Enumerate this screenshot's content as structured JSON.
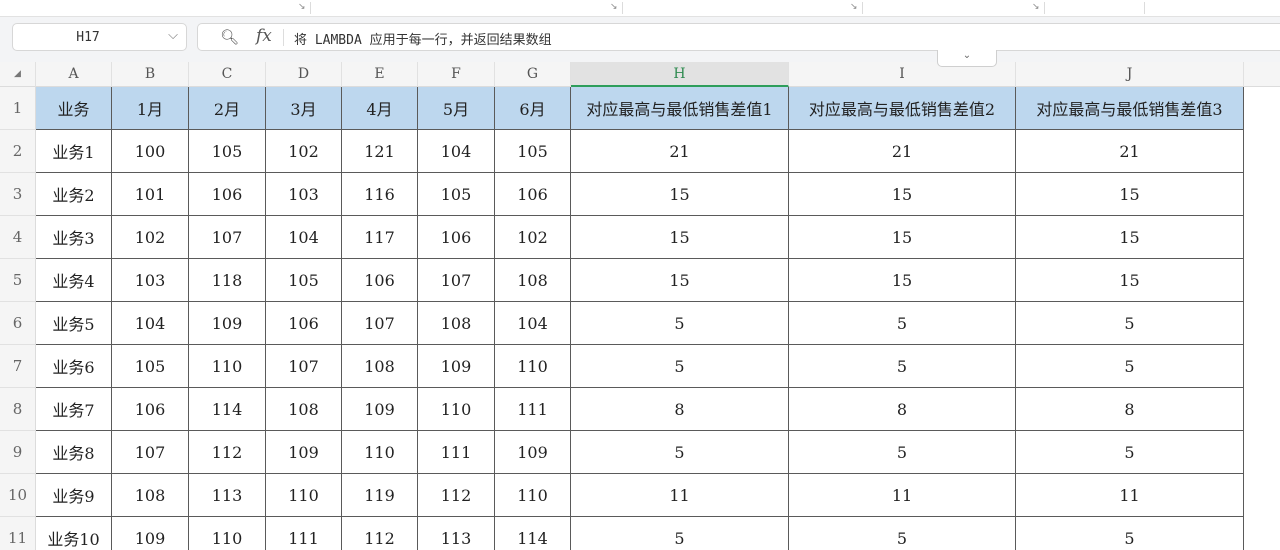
{
  "colors": {
    "header_fill": "#bdd7ee",
    "selected_column_accent": "#2e9e5b",
    "grid_border": "#5a5a5a"
  },
  "formula_bar": {
    "name_box": "H17",
    "zoom_icon": "magnifier-icon",
    "fx_label": "fx",
    "formula": "将 LAMBDA 应用于每一行，并返回结果数组"
  },
  "column_letters": [
    "A",
    "B",
    "C",
    "D",
    "E",
    "F",
    "G",
    "H",
    "I",
    "J"
  ],
  "selected_column": "H",
  "row_numbers": [
    "1",
    "2",
    "3",
    "4",
    "5",
    "6",
    "7",
    "8",
    "9",
    "10",
    "11"
  ],
  "table": {
    "headers": [
      "业务",
      "1月",
      "2月",
      "3月",
      "4月",
      "5月",
      "6月",
      "对应最高与最低销售差值1",
      "对应最高与最低销售差值2",
      "对应最高与最低销售差值3"
    ],
    "rows": [
      [
        "业务1",
        "100",
        "105",
        "102",
        "121",
        "104",
        "105",
        "21",
        "21",
        "21"
      ],
      [
        "业务2",
        "101",
        "106",
        "103",
        "116",
        "105",
        "106",
        "15",
        "15",
        "15"
      ],
      [
        "业务3",
        "102",
        "107",
        "104",
        "117",
        "106",
        "102",
        "15",
        "15",
        "15"
      ],
      [
        "业务4",
        "103",
        "118",
        "105",
        "106",
        "107",
        "108",
        "15",
        "15",
        "15"
      ],
      [
        "业务5",
        "104",
        "109",
        "106",
        "107",
        "108",
        "104",
        "5",
        "5",
        "5"
      ],
      [
        "业务6",
        "105",
        "110",
        "107",
        "108",
        "109",
        "110",
        "5",
        "5",
        "5"
      ],
      [
        "业务7",
        "106",
        "114",
        "108",
        "109",
        "110",
        "111",
        "8",
        "8",
        "8"
      ],
      [
        "业务8",
        "107",
        "112",
        "109",
        "110",
        "111",
        "109",
        "5",
        "5",
        "5"
      ],
      [
        "业务9",
        "108",
        "113",
        "110",
        "119",
        "112",
        "110",
        "11",
        "11",
        "11"
      ],
      [
        "业务10",
        "109",
        "110",
        "111",
        "112",
        "113",
        "114",
        "5",
        "5",
        "5"
      ]
    ]
  }
}
